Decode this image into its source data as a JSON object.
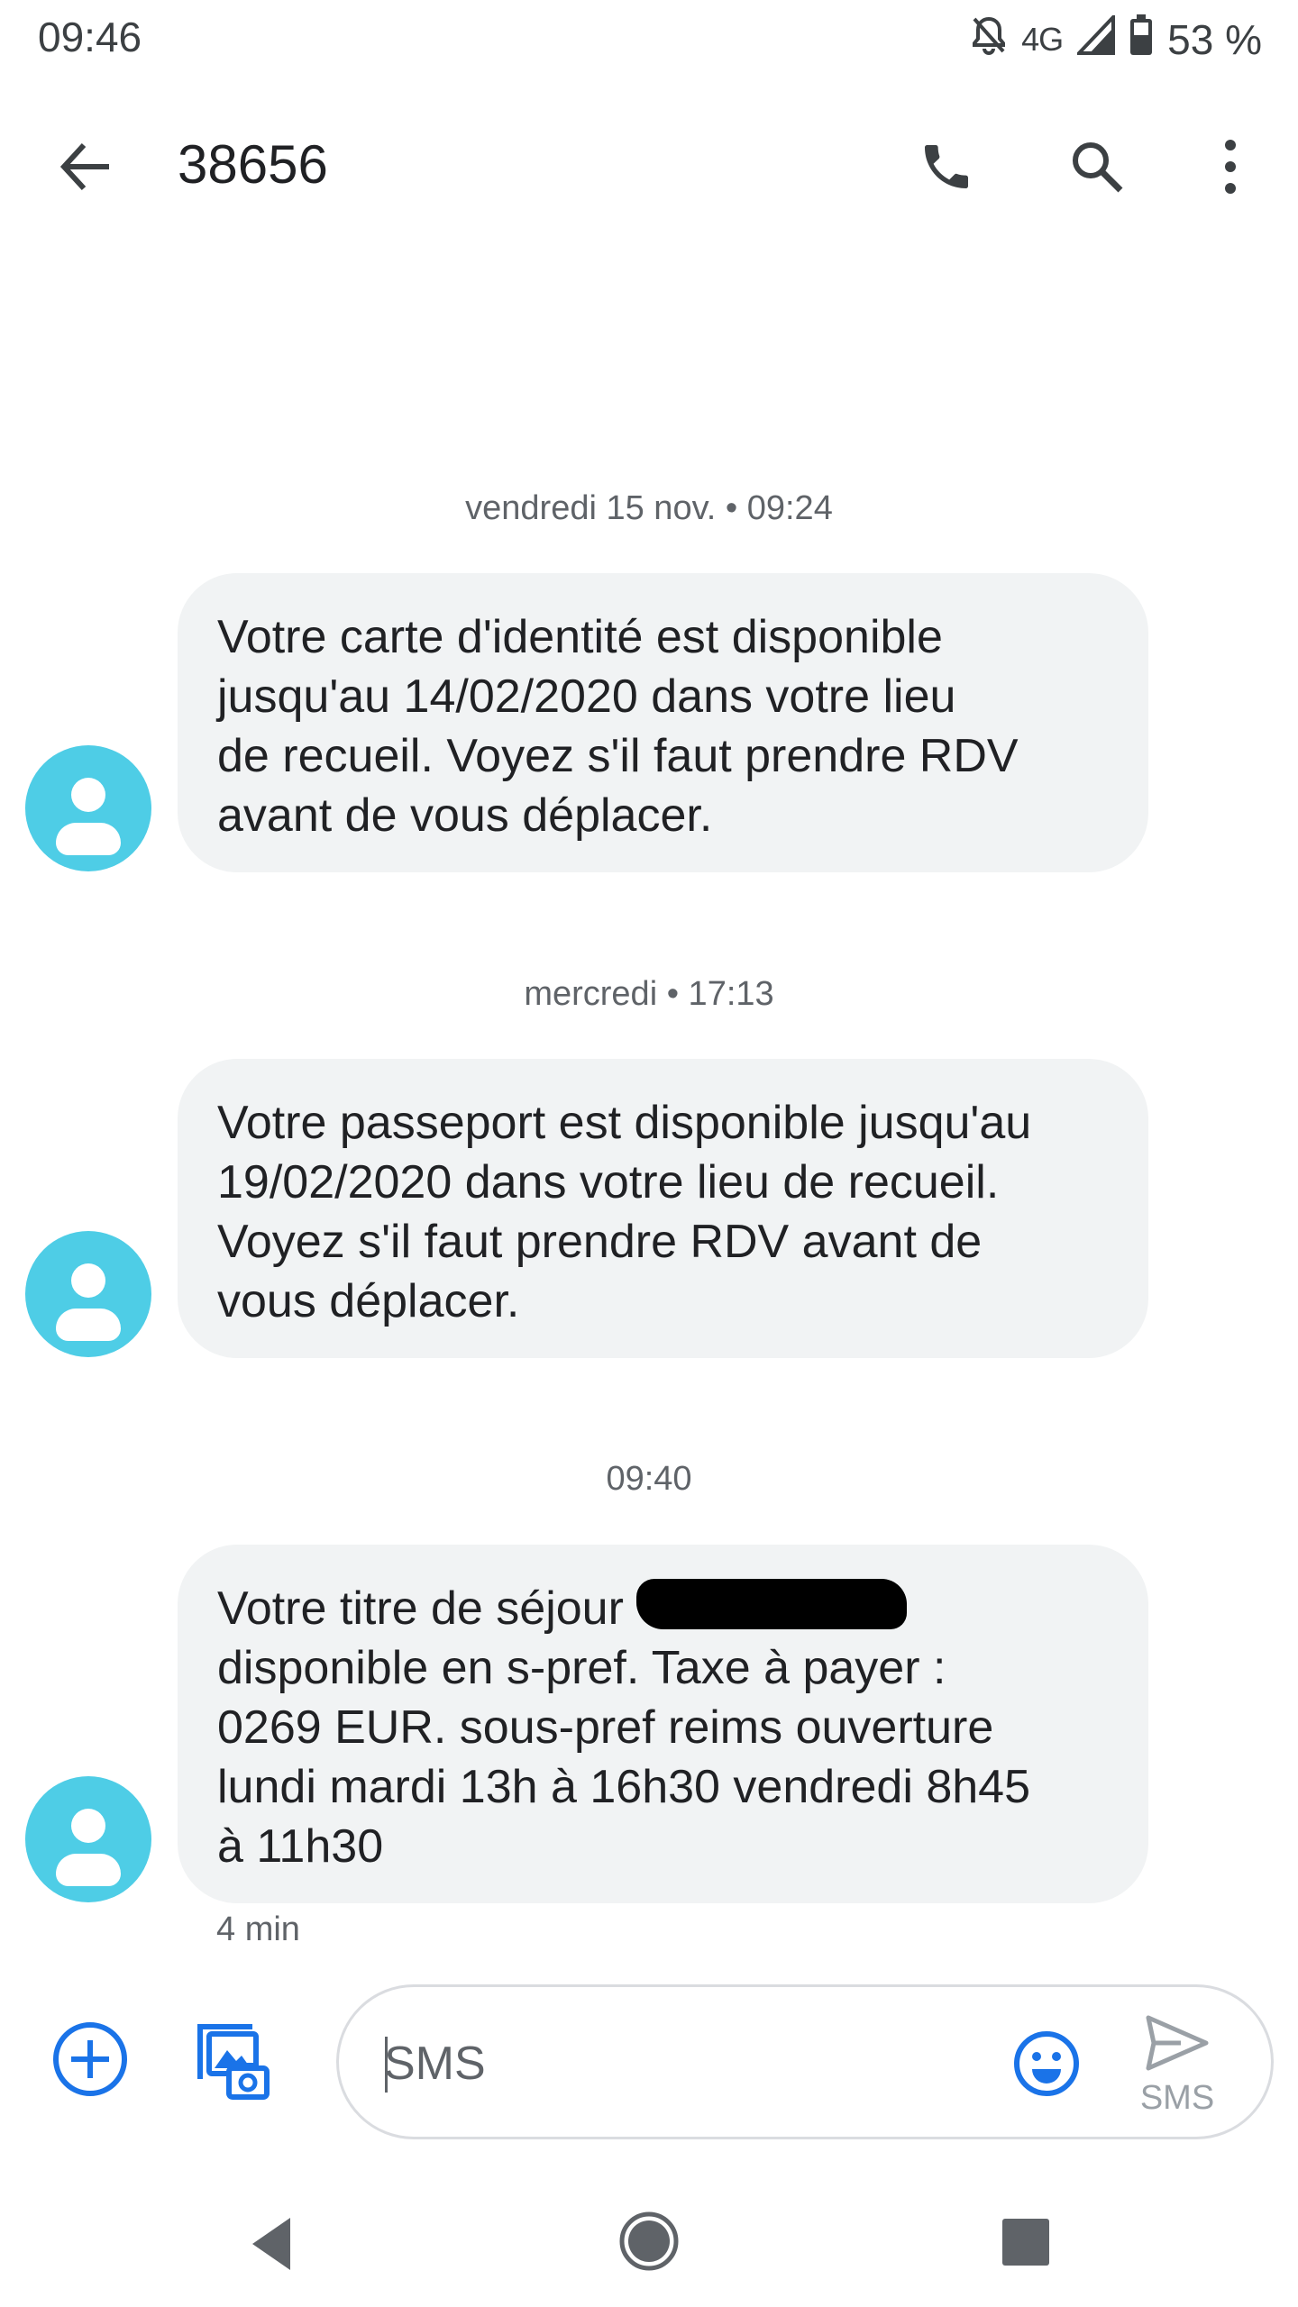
{
  "status_bar": {
    "time": "09:46",
    "network": "4G",
    "battery": "53 %",
    "icons": [
      "notifications-off-icon",
      "signal-icon",
      "battery-icon"
    ]
  },
  "header": {
    "title": "38656",
    "icons": [
      "back-arrow-icon",
      "phone-icon",
      "search-icon",
      "more-vert-icon"
    ]
  },
  "conversation": {
    "messages": [
      {
        "timestamp": "vendredi 15 nov. • 09:24",
        "text": "Votre carte d'identité est disponible\njusqu'au 14/02/2020 dans votre lieu\nde recueil. Voyez s'il faut prendre RDV\navant de vous déplacer."
      },
      {
        "timestamp": "mercredi • 17:13",
        "text": "Votre passeport est disponible jusqu'au\n19/02/2020 dans votre lieu de recueil.\nVoyez s'il faut prendre RDV avant de\nvous déplacer."
      },
      {
        "timestamp": "09:40",
        "text_before_redaction": "Votre titre de séjour ",
        "text_after_redaction": "\ndisponible en s-pref. Taxe à payer :\n0269 EUR.  sous-pref reims ouverture\nlundi mardi 13h à 16h30 vendredi 8h45\nà 11h30",
        "age": "4 min"
      }
    ]
  },
  "compose": {
    "placeholder": "SMS",
    "value": "",
    "send_label": "SMS",
    "icons": [
      "add-circle-icon",
      "media-gallery-icon",
      "emoji-icon",
      "send-icon"
    ]
  },
  "colors": {
    "accent": "#1a73e8",
    "avatar": "#4ecde6",
    "bubble": "#f1f3f4",
    "secondary_text": "#5f6368"
  }
}
